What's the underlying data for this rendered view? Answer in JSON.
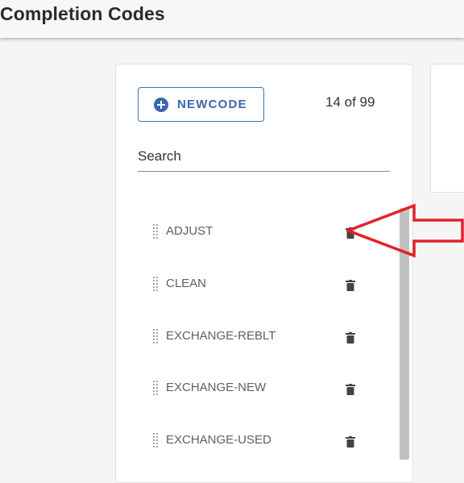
{
  "header": {
    "title": "Completion Codes"
  },
  "toolbar": {
    "new_label": "NEWCODE",
    "count_text": "14 of 99"
  },
  "search": {
    "label": "Search"
  },
  "items": [
    {
      "label": "ADJUST"
    },
    {
      "label": "CLEAN"
    },
    {
      "label": "EXCHANGE-REBLT"
    },
    {
      "label": "EXCHANGE-NEW"
    },
    {
      "label": "EXCHANGE-USED"
    }
  ],
  "colors": {
    "accent": "#3b67ad",
    "annotation_arrow": "#e0222a",
    "icon": "#444444"
  },
  "icons": {
    "new": "plus-circle-icon",
    "item_handle": "drag-handle-icon",
    "item_action": "trash-icon"
  }
}
